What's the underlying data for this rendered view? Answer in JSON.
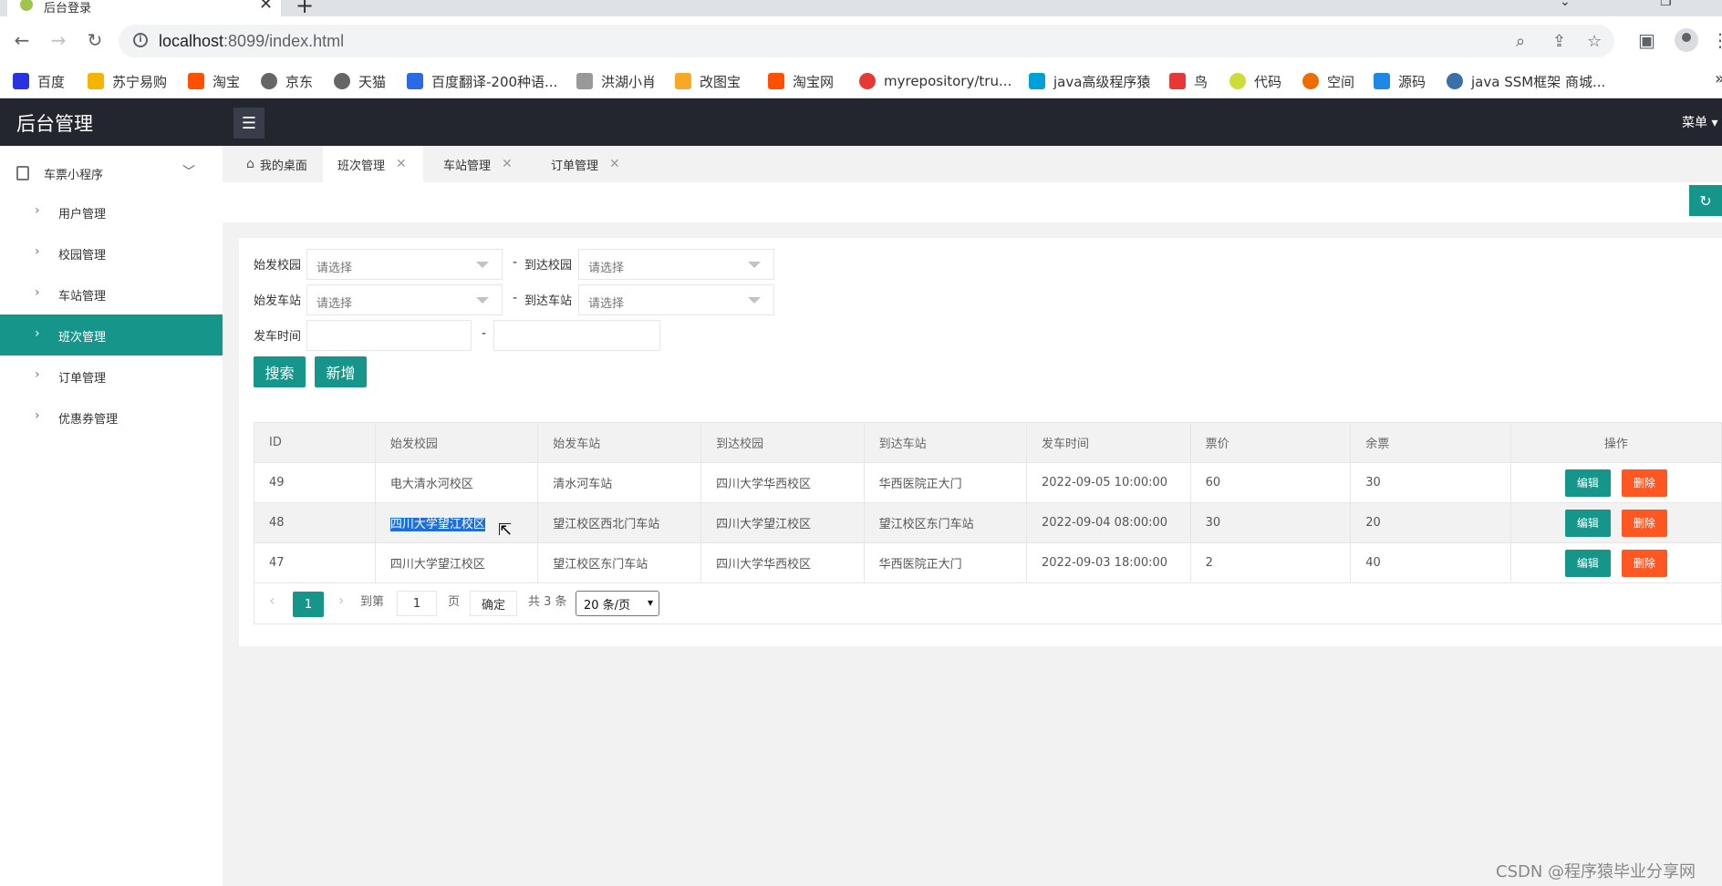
{
  "browser": {
    "tab_title": "后台登录",
    "url_host": "localhost",
    "url_rest": ":8099/index.html",
    "bookmarks": [
      {
        "label": "百度",
        "color": "#2932e1"
      },
      {
        "label": "苏宁易购",
        "color": "#f5b400"
      },
      {
        "label": "淘宝",
        "color": "#ff5000"
      },
      {
        "label": "京东",
        "color": "#666666"
      },
      {
        "label": "天猫",
        "color": "#666666"
      },
      {
        "label": "百度翻译-200种语...",
        "color": "#2a6ae9"
      },
      {
        "label": "洪湖小肖",
        "color": "#999999"
      },
      {
        "label": "改图宝",
        "color": "#f9a825"
      },
      {
        "label": "淘宝网",
        "color": "#ff5000"
      },
      {
        "label": "myrepository/tru...",
        "color": "#e53935"
      },
      {
        "label": "java高级程序猿",
        "color": "#00a1d6"
      },
      {
        "label": "鸟",
        "color": "#e53935"
      },
      {
        "label": "代码",
        "color": "#cddc39"
      },
      {
        "label": "空间",
        "color": "#ef6c00"
      },
      {
        "label": "源码",
        "color": "#1e88e5"
      },
      {
        "label": "java SSM框架 商城...",
        "color": "#3c6ea8"
      }
    ]
  },
  "header": {
    "logo": "后台管理",
    "menu_label": "菜单"
  },
  "sidebar": {
    "parent_label": "车票小程序",
    "items": [
      {
        "label": "用户管理",
        "active": false
      },
      {
        "label": "校园管理",
        "active": false
      },
      {
        "label": "车站管理",
        "active": false
      },
      {
        "label": "班次管理",
        "active": true
      },
      {
        "label": "订单管理",
        "active": false
      },
      {
        "label": "优惠券管理",
        "active": false
      }
    ]
  },
  "tabs": [
    {
      "label": "我的桌面",
      "closable": false,
      "active": false
    },
    {
      "label": "班次管理",
      "closable": true,
      "active": true
    },
    {
      "label": "车站管理",
      "closable": true,
      "active": false
    },
    {
      "label": "订单管理",
      "closable": true,
      "active": false
    }
  ],
  "filters": {
    "start_campus_label": "始发校园",
    "end_campus_label": "到达校园",
    "start_station_label": "始发车站",
    "end_station_label": "到达车站",
    "depart_time_label": "发车时间",
    "select_placeholder": "请选择",
    "dash": "-",
    "search_btn": "搜索",
    "add_btn": "新增"
  },
  "table": {
    "columns": [
      "ID",
      "始发校园",
      "始发车站",
      "到达校园",
      "到达车站",
      "发车时间",
      "票价",
      "余票",
      "操作"
    ],
    "edit_label": "编辑",
    "delete_label": "删除",
    "rows": [
      {
        "id": "49",
        "start_campus": "电大清水河校区",
        "start_station": "清水河车站",
        "end_campus": "四川大学华西校区",
        "end_station": "华西医院正大门",
        "time": "2022-09-05 10:00:00",
        "price": "60",
        "remain": "30"
      },
      {
        "id": "48",
        "start_campus": "四川大学望江校区",
        "start_station": "望江校区西北门车站",
        "end_campus": "四川大学望江校区",
        "end_station": "望江校区东门车站",
        "time": "2022-09-04 08:00:00",
        "price": "30",
        "remain": "20"
      },
      {
        "id": "47",
        "start_campus": "四川大学望江校区",
        "start_station": "望江校区东门车站",
        "end_campus": "四川大学华西校区",
        "end_station": "华西医院正大门",
        "time": "2022-09-03 18:00:00",
        "price": "2",
        "remain": "40"
      }
    ]
  },
  "pager": {
    "current": "1",
    "goto_label": "到第",
    "goto_value": "1",
    "page_unit": "页",
    "confirm": "确定",
    "total": "共 3 条",
    "page_size": "20 条/页"
  },
  "watermark": "CSDN @程序猿毕业分享网"
}
